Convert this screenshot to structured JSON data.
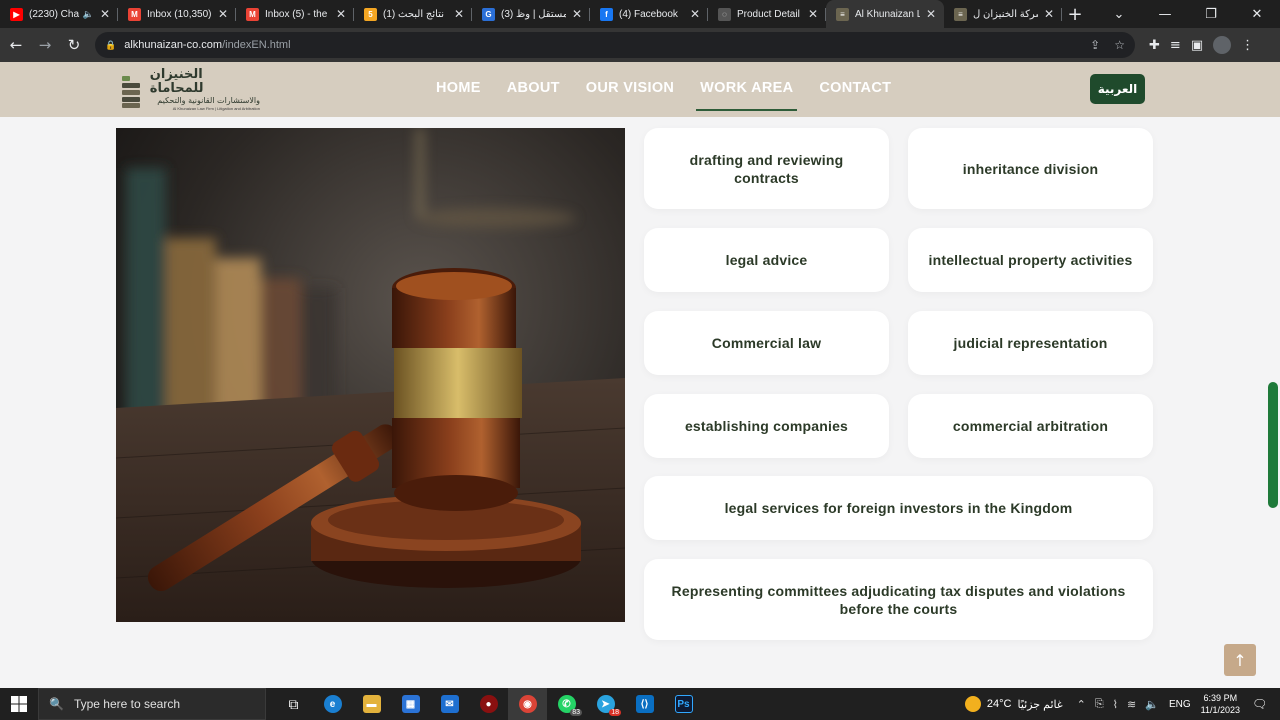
{
  "browser": {
    "tabs": [
      {
        "title": "(2230) Cha",
        "favicon_color": "#ff0000",
        "favicon_glyph": "▶",
        "extra": "🔈"
      },
      {
        "title": "Inbox (10,350)",
        "favicon_color": "#ea4335",
        "favicon_glyph": "M"
      },
      {
        "title": "Inbox (5) - the",
        "favicon_color": "#ea4335",
        "favicon_glyph": "M"
      },
      {
        "title": "(1) نتائج البحث",
        "favicon_color": "#f4a623",
        "favicon_glyph": "5"
      },
      {
        "title": "(3) مستقل | وظ",
        "favicon_color": "#2b6fd6",
        "favicon_glyph": "G"
      },
      {
        "title": "(4) Facebook",
        "favicon_color": "#1877f2",
        "favicon_glyph": "f"
      },
      {
        "title": "Product Detail",
        "favicon_color": "#555555",
        "favicon_glyph": "◌"
      },
      {
        "title": "Al Khunaizan L",
        "favicon_color": "#6b6550",
        "favicon_glyph": "≡",
        "active": true
      },
      {
        "title": "شركة الخنيزان ل",
        "favicon_color": "#6b6550",
        "favicon_glyph": "≡"
      }
    ],
    "new_tab_label": "+",
    "url_host": "alkhunaizan-co.com",
    "url_path": "/indexEN.html"
  },
  "site": {
    "logo": {
      "arabic_title": "الخنيزان للمحاماة",
      "arabic_subtitle": "والاستشارات القانونية والتحكيم",
      "english_line": "Al Khunaizan Law Firm | Litigation and Arbitration"
    },
    "nav": [
      {
        "label": "HOME"
      },
      {
        "label": "ABOUT"
      },
      {
        "label": "OUR VISION"
      },
      {
        "label": "WORK AREA",
        "active": true
      },
      {
        "label": "CONTACT"
      }
    ],
    "language_button": "العربية"
  },
  "work_areas": [
    "drafting and reviewing contracts",
    "inheritance division",
    "legal advice",
    "intellectual property activities",
    "Commercial law",
    "judicial representation",
    "establishing companies",
    "commercial arbitration",
    "legal services for foreign investors in the Kingdom",
    "Representing committees adjudicating tax disputes and violations before the courts"
  ],
  "scroll_top_icon": "arrow-up-icon",
  "taskbar": {
    "search_placeholder": "Type here to search",
    "whatsapp_badge": "83",
    "telegram_badge": "18",
    "weather_temp": "24°C",
    "weather_text": "غائم جزئيًا",
    "language": "ENG",
    "time": "6:39 PM",
    "date": "11/1/2023"
  }
}
